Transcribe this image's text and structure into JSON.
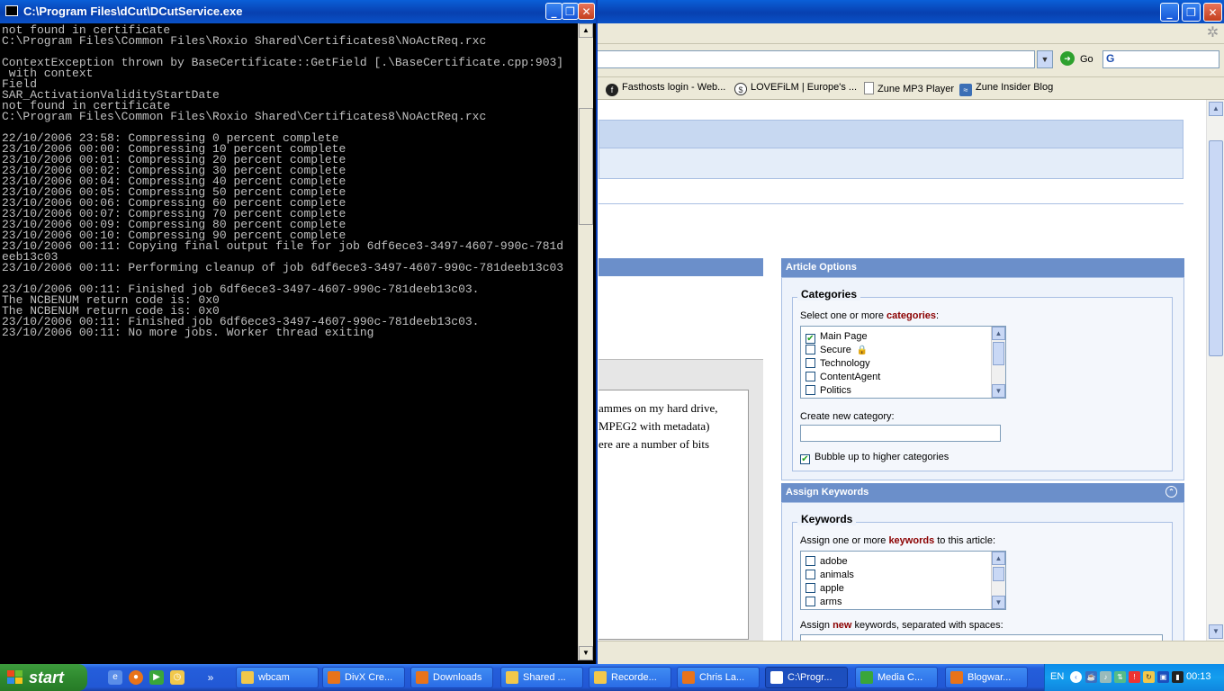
{
  "browser": {
    "go_label": "Go",
    "search_logo": "G",
    "bookmarks": [
      {
        "label": "Fasthosts login - Web...",
        "icon": "fasthosts-icon"
      },
      {
        "label": "LOVEFiLM | Europe's ...",
        "icon": "lovefilm-icon"
      },
      {
        "label": "Zune MP3 Player",
        "icon": "page-icon"
      },
      {
        "label": "Zune Insider Blog",
        "icon": "blog-icon"
      }
    ],
    "editor_lines": [
      "ammes on my hard drive,",
      "MPEG2 with metadata)",
      "ere are a number of bits"
    ],
    "article_options": {
      "header": "Article Options",
      "categories_legend": "Categories",
      "select_prefix": "Select one or more ",
      "select_keyword": "categories",
      "select_suffix": ":",
      "categories": [
        {
          "label": "Main Page",
          "checked": true
        },
        {
          "label": "Secure",
          "checked": false,
          "locked": true
        },
        {
          "label": "Technology",
          "checked": false
        },
        {
          "label": "ContentAgent",
          "checked": false
        },
        {
          "label": "Politics",
          "checked": false
        }
      ],
      "create_label": "Create new category:",
      "create_value": "",
      "bubble_label": "Bubble up to higher categories",
      "bubble_checked": true
    },
    "assign_keywords": {
      "header": "Assign Keywords",
      "legend": "Keywords",
      "assign_prefix": "Assign one or more ",
      "assign_keyword": "keywords",
      "assign_suffix": " to this article:",
      "keywords": [
        {
          "label": "adobe",
          "checked": false
        },
        {
          "label": "animals",
          "checked": false
        },
        {
          "label": "apple",
          "checked": false
        },
        {
          "label": "arms",
          "checked": false
        }
      ],
      "new_prefix": "Assign ",
      "new_keyword": "new",
      "new_suffix": " keywords, separated with spaces:"
    }
  },
  "console": {
    "title": "C:\\Program Files\\dCut\\DCutService.exe",
    "lines": [
      "not found in certificate",
      "C:\\Program Files\\Common Files\\Roxio Shared\\Certificates8\\NoActReq.rxc",
      "",
      "ContextException thrown by BaseCertificate::GetField [.\\BaseCertificate.cpp:903]",
      " with context",
      "Field",
      "SAR_ActivationValidityStartDate",
      "not found in certificate",
      "C:\\Program Files\\Common Files\\Roxio Shared\\Certificates8\\NoActReq.rxc",
      "",
      "22/10/2006 23:58: Compressing 0 percent complete",
      "23/10/2006 00:00: Compressing 10 percent complete",
      "23/10/2006 00:01: Compressing 20 percent complete",
      "23/10/2006 00:02: Compressing 30 percent complete",
      "23/10/2006 00:04: Compressing 40 percent complete",
      "23/10/2006 00:05: Compressing 50 percent complete",
      "23/10/2006 00:06: Compressing 60 percent complete",
      "23/10/2006 00:07: Compressing 70 percent complete",
      "23/10/2006 00:09: Compressing 80 percent complete",
      "23/10/2006 00:10: Compressing 90 percent complete",
      "23/10/2006 00:11: Copying final output file for job 6df6ece3-3497-4607-990c-781d",
      "eeb13c03",
      "23/10/2006 00:11: Performing cleanup of job 6df6ece3-3497-4607-990c-781deeb13c03",
      "",
      "23/10/2006 00:11: Finished job 6df6ece3-3497-4607-990c-781deeb13c03.",
      "The NCBENUM return code is: 0x0",
      "The NCBENUM return code is: 0x0",
      "23/10/2006 00:11: Finished job 6df6ece3-3497-4607-990c-781deeb13c03.",
      "23/10/2006 00:11: No more jobs. Worker thread exiting"
    ]
  },
  "taskbar": {
    "start_label": "start",
    "tasks": [
      {
        "label": "wbcam",
        "icon": "folder-icon",
        "color": "#f2c84b"
      },
      {
        "label": "DivX Cre...",
        "icon": "firefox-icon",
        "color": "#e8731a"
      },
      {
        "label": "Downloads",
        "icon": "firefox-icon",
        "color": "#e8731a"
      },
      {
        "label": "Shared ...",
        "icon": "folder-icon",
        "color": "#f2c84b"
      },
      {
        "label": "Recorde...",
        "icon": "folder-icon",
        "color": "#f2c84b"
      },
      {
        "label": "Chris La...",
        "icon": "firefox-icon",
        "color": "#e8731a"
      },
      {
        "label": "C:\\Progr...",
        "icon": "console-icon",
        "color": "#ffffff",
        "active": true
      },
      {
        "label": "Media C...",
        "icon": "media-center-icon",
        "color": "#3aa63a"
      },
      {
        "label": "Blogwar...",
        "icon": "firefox-icon",
        "color": "#e8731a"
      }
    ],
    "language": "EN",
    "clock": "00:13"
  }
}
